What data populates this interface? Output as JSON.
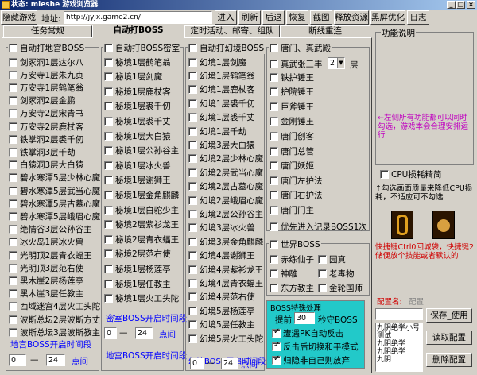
{
  "window": {
    "title": "状态: mieshe 游戏浏览器"
  },
  "toolbar": {
    "hide_game": "隐藏游戏",
    "address_label": "地址:",
    "address_value": "http://jyjx.game2.cn/",
    "enter": "进入",
    "refresh": "刷新",
    "back": "后退",
    "restore": "恢复",
    "screenshot": "截图",
    "release": "释放资源",
    "black_screen": "黑屏优化",
    "log": "日志"
  },
  "tabs": [
    "任务常规",
    "自动打BOSS",
    "定时活动、邮寄、组队",
    "断线重连"
  ],
  "group1": {
    "title": "自动打地宫BOSS",
    "items": [
      "剑冢洞1层达尔八",
      "万安寺1层朱九贞",
      "万安寺1层鹤笔翁",
      "剑冢洞2层金鹏",
      "万安寺2层宋青书",
      "万安寺2层鹿杖客",
      "铁掌洞2层裘千仞",
      "铁掌洞3层千劫",
      "白猿洞3层大白猿",
      "碧水寒潭5层少林心魔",
      "碧水寒潭5层武当心魔",
      "碧水寒潭5层古墓心魔",
      "碧水寒潭5层峨眉心魔",
      "绝情谷3层公孙谷主",
      "冰火岛1层冰火兽",
      "光明顶2层青衣蝠王",
      "光明顶3层范右使",
      "黑木崖2层杨莲亭",
      "黑木崖3层任教主",
      "西域迷宫4层火工头陀",
      "波斯总坛2层波斯方丈",
      "波斯总坛3层波斯教主"
    ],
    "time_label": "地宫BOSS开启时间段",
    "from": "0",
    "to": "24",
    "unit": "点间"
  },
  "group2": {
    "title": "自动打BOSS密室",
    "items": [
      "秘境1层鹤笔翁",
      "秘境1层剑魔",
      "秘境1层鹿杖客",
      "秘境1层裘千仞",
      "秘境1层裘千丈",
      "秘境1层大白猿",
      "秘境1层公孙谷主",
      "秘境1层冰火兽",
      "秘境1层谢狮王",
      "秘境1层金角麒麟",
      "秘境1层白驼少主",
      "秘境2层紫衫龙王",
      "秘境2层青衣蝠王",
      "秘境2层范右使",
      "秘境1层杨莲亭",
      "秘境1层任教主",
      "秘境1层火工头陀"
    ],
    "time_label": "密室BOSS开启时间段",
    "from": "0",
    "to": "24",
    "unit": "点间"
  },
  "group3": {
    "title": "自动打幻境BOSS",
    "items": [
      "幻境1层剑魔",
      "幻境1层鹤笔翁",
      "幻境1层鹿杖客",
      "幻境1层裘千仞",
      "幻境1层裘千丈",
      "幻境1层千劫",
      "幻境3层大白猿",
      "幻境2层少林心魔",
      "幻境2层武当心魔",
      "幻境2层古墓心魔",
      "幻境2层峨眉心魔",
      "幻境2层公孙谷主",
      "幻境3层冰火兽",
      "幻境3层金角麒麟",
      "幻境4层谢狮王",
      "幻境4层紫衫龙王",
      "幻境4层青衣蝠王",
      "幻境4层范右使",
      "幻境5层杨莲亭",
      "幻境5层任教主",
      "幻境5层火工头陀"
    ],
    "time_label": "幻境BOSS开启时间段",
    "from": "0",
    "to": "24",
    "unit": "点间"
  },
  "group4": {
    "title": "唐门、真武殿",
    "zhenwu_label": "真武张三丰",
    "zhenwu_value": "2",
    "zhenwu_unit": "层",
    "items": [
      "铁护锤王",
      "护院锤王",
      "巨斧锤王",
      "金刚锤王",
      "唐门创客",
      "唐门总管",
      "唐门妖姬",
      "唐门左护法",
      "唐门右护法",
      "唐门门主"
    ],
    "priority": "优先进入记录BOSS1次"
  },
  "group5": {
    "title": "世界BOSS",
    "items": [
      "赤练仙子",
      "园真",
      "神雕",
      "老毒物",
      "东方教主",
      "金轮国师"
    ]
  },
  "group6": {
    "title": "BOSS特殊处理",
    "advance": "提前",
    "advance_value": "30",
    "advance_unit": "秒守BOSS",
    "items": [
      "遭遇PK自动反击",
      "反击后切换和平模式",
      "归隐非自己则放弃"
    ]
  },
  "right": {
    "help_title": "功能说明",
    "help_text": "←左侧所有功能都可以同时勾选，游戏本会合理安排运行",
    "cpu_label": "CPU损耗精简",
    "cpu_note": "↑勾选画面质量来降低CPU损耗，不适应可不勾选",
    "skill_text": "快捷键Ctrl0回城袋，快捷键2储便放个技能或者默认的",
    "config_label": "配置名:",
    "config_value": "配置",
    "save_btn": "保存_使用",
    "read_btn": "读取配置",
    "delete_btn": "删除配置",
    "list_items": [
      "九阴绝学小号",
      "测试",
      "九阴绝学",
      "九阴绝学",
      "九阴"
    ]
  },
  "colors": {
    "title_bg": "#0a246a",
    "teal": "#22c9c9",
    "blue_text": "#0000ff",
    "red_text": "#d00000"
  }
}
